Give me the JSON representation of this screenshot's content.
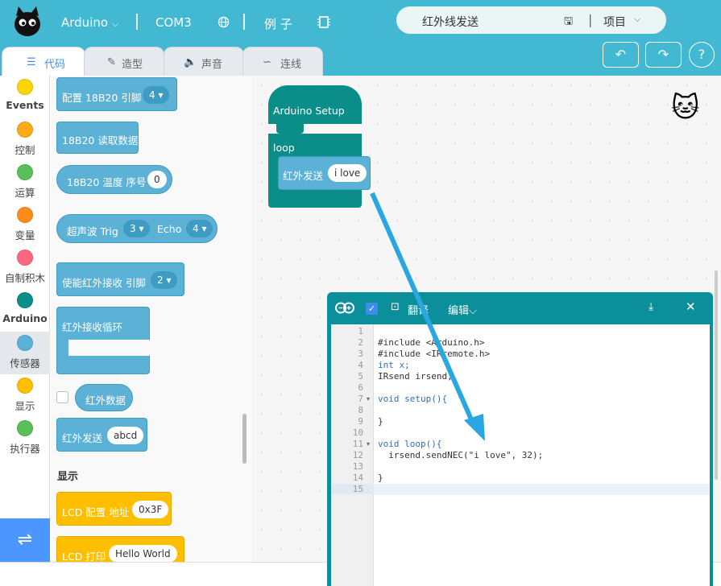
{
  "topbar": {
    "board": "Arduino",
    "port": "COM3",
    "examples": "例 子",
    "project_name": "红外线发送",
    "project_menu": "项目"
  },
  "tabs": [
    {
      "label": "代码",
      "icon": "code-icon"
    },
    {
      "label": "造型",
      "icon": "brush-icon"
    },
    {
      "label": "声音",
      "icon": "speaker-icon"
    },
    {
      "label": "连线",
      "icon": "wire-icon"
    }
  ],
  "toolbar": {
    "undo": "↶",
    "redo": "↷",
    "help": "?"
  },
  "categories": [
    {
      "label": "Events",
      "color": "#ffd500"
    },
    {
      "label": "控制",
      "color": "#ffab19"
    },
    {
      "label": "运算",
      "color": "#59c059"
    },
    {
      "label": "变量",
      "color": "#ff8c1a"
    },
    {
      "label": "自制积木",
      "color": "#ff6680"
    },
    {
      "label": "Arduino",
      "color": "#0b8e89"
    },
    {
      "label": "传感器",
      "color": "#5cb1d6"
    },
    {
      "label": "显示",
      "color": "#ffbf00"
    },
    {
      "label": "执行器",
      "color": "#59c059"
    }
  ],
  "palette": {
    "b1_text": "配置 18B20 引脚",
    "b1_val": "4",
    "b2_text": "18B20 读取数据",
    "b3_text": "18B20 温度 序号",
    "b3_val": "0",
    "b4_text1": "超声波 Trig",
    "b4_val1": "3",
    "b4_text2": "Echo",
    "b4_val2": "4",
    "b5_text": "使能红外接收 引脚",
    "b5_val": "2",
    "b6_text": "红外接收循环",
    "b7_text": "红外数据",
    "b8_text": "红外发送",
    "b8_val": "abcd",
    "section_display": "显示",
    "b9_text": "LCD 配置 地址",
    "b9_val": "0x3F",
    "b10_text": "LCD 打印",
    "b10_val": "Hello World"
  },
  "workspace": {
    "setup_label": "Arduino Setup",
    "loop_label": "loop",
    "send_label": "红外发送",
    "send_val": "i love"
  },
  "code_window": {
    "translate": "翻译",
    "edit": "编辑",
    "line_numbers": [
      "1",
      "2",
      "3",
      "4",
      "5",
      "6",
      "7",
      "8",
      "9",
      "10",
      "11",
      "12",
      "13",
      "14",
      "15"
    ],
    "lines": [
      "",
      "#include <Arduino.h>",
      "#include <IRremote.h>",
      "int x;",
      "IRsend irsend;",
      "",
      "void setup(){",
      "",
      "}",
      "",
      "void loop(){",
      "  irsend.sendNEC(\"i love\", 32);",
      "",
      "}",
      ""
    ]
  }
}
